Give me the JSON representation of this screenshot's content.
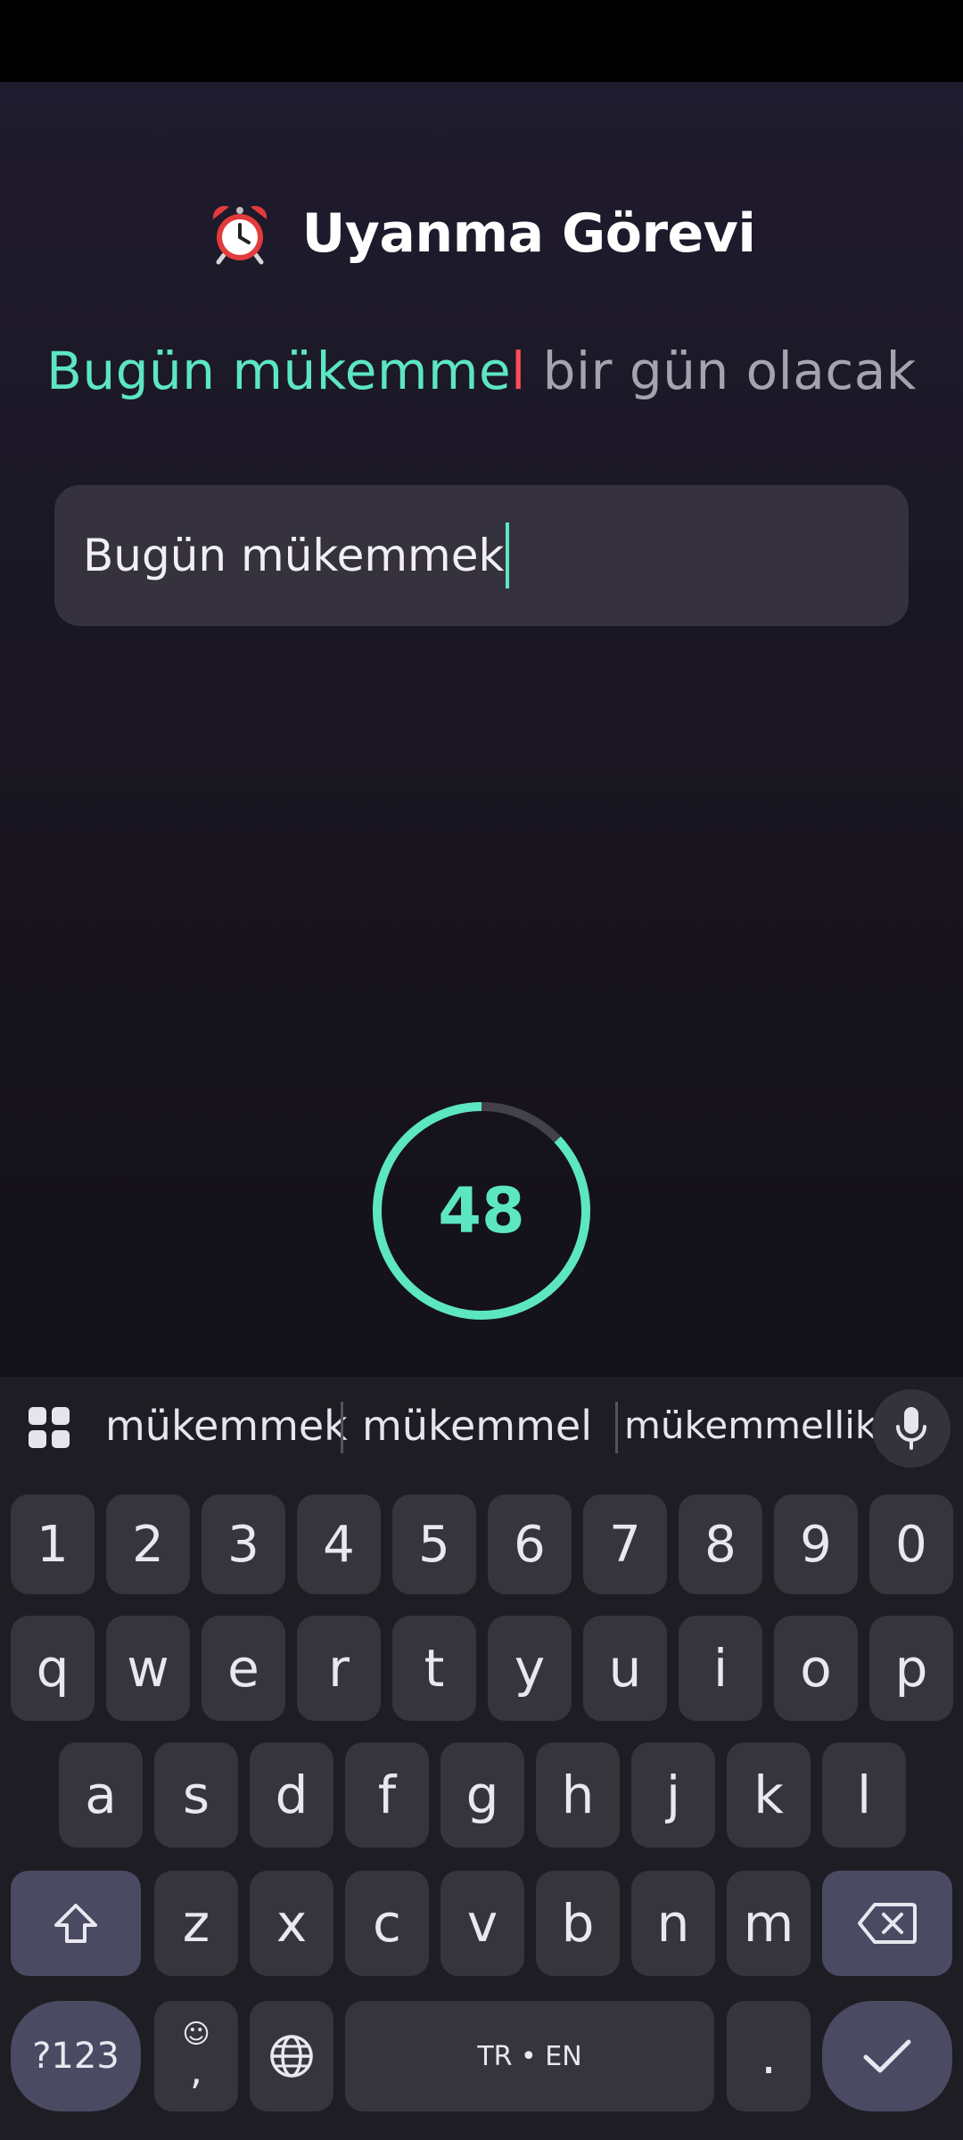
{
  "app": {
    "title": "Uyanma Görevi",
    "title_icon": "alarm-clock-icon",
    "target_sentence": {
      "correct": "Bugün mükemme",
      "error": "l",
      "remaining": " bir gün olacak"
    },
    "input_value": "Bugün mükemmek",
    "timer": {
      "seconds_remaining": "48",
      "progress_fraction": 0.87
    },
    "colors": {
      "accent": "#5ce6c2",
      "error": "#ff4d57",
      "remaining_text": "#a6a2b0",
      "background": "#1f1b2e"
    }
  },
  "keyboard": {
    "suggestions": [
      "mükemmek",
      "mükemmel",
      "mükemmellik"
    ],
    "number_row": [
      "1",
      "2",
      "3",
      "4",
      "5",
      "6",
      "7",
      "8",
      "9",
      "0"
    ],
    "row1": [
      "q",
      "w",
      "e",
      "r",
      "t",
      "y",
      "u",
      "i",
      "o",
      "p"
    ],
    "row2": [
      "a",
      "s",
      "d",
      "f",
      "g",
      "h",
      "j",
      "k",
      "l"
    ],
    "row3": [
      "z",
      "x",
      "c",
      "v",
      "b",
      "n",
      "m"
    ],
    "symbols_label": "?123",
    "comma_label": ",",
    "emoji_label": "☺",
    "space_label": "TR • EN",
    "period_label": ".",
    "icons": {
      "apps": "apps-grid-icon",
      "mic": "mic-icon",
      "shift": "shift-icon",
      "backspace": "backspace-icon",
      "globe": "globe-icon",
      "enter": "checkmark-icon"
    }
  }
}
